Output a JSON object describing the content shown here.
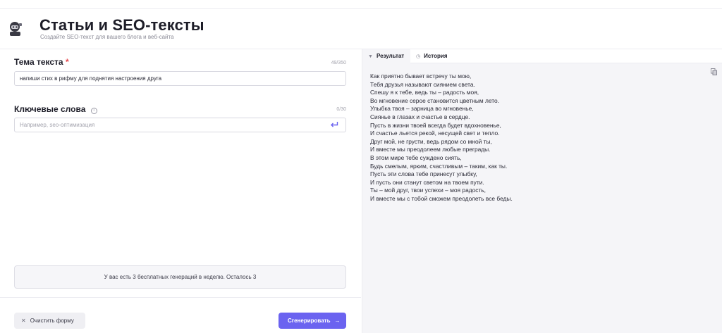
{
  "header": {
    "title": "Статьи и SEO-тексты",
    "subtitle": "Создайте SEO-текст для вашего блога и веб-сайта",
    "avatar_icon": "robot-avatar-icon"
  },
  "form": {
    "topic": {
      "label": "Тема текста",
      "required_mark": "*",
      "counter": "49/350",
      "value": "напиши стих в рифму для поднятия настроения друга"
    },
    "keywords": {
      "label": "Ключевые слова",
      "info_icon": "info-icon",
      "counter": "0/30",
      "placeholder": "Например, seo-оптимизация",
      "enter_icon": "enter-icon"
    },
    "notice": "У вас есть 3 бесплатных генераций в неделю. Осталось 3",
    "clear_button": "Очистить форму",
    "generate_button": "Сгенерировать"
  },
  "result_panel": {
    "tabs": [
      {
        "label": "Результат",
        "icon": "pin-icon",
        "active": true
      },
      {
        "label": "История",
        "icon": "clock-icon",
        "active": false
      }
    ],
    "copy_icon": "copy-icon",
    "lines": [
      "Как приятно бывает встречу ты мою,",
      "Тебя друзья называют сиянием света.",
      "Спешу я к тебе, ведь ты – радость моя,",
      "Во мгновение серое становится цветным лето.",
      "Улыбка твоя – зарница во мгновенье,",
      "Сиянье в глазах и счастье в сердце.",
      "Пусть в жизни твоей всегда будет вдохновенье,",
      "И счастье льется рекой, несущей свет и тепло.",
      "Друг мой, не грусти, ведь рядом со мной ты,",
      "И вместе мы преодолеем любые преграды.",
      "В этом мире тебе суждено сиять,",
      "Будь смелым, ярким, счастливым – таким, как ты.",
      "Пусть эти слова тебе принесут улыбку,",
      "И пусть они станут светом на твоем пути.",
      "Ты – мой друг, твои успехи – моя радость,",
      "И вместе мы с тобой сможем преодолеть все беды."
    ]
  },
  "colors": {
    "accent": "#6b63f0",
    "required": "#e5484d",
    "panel_bg": "#f5f5f8"
  }
}
